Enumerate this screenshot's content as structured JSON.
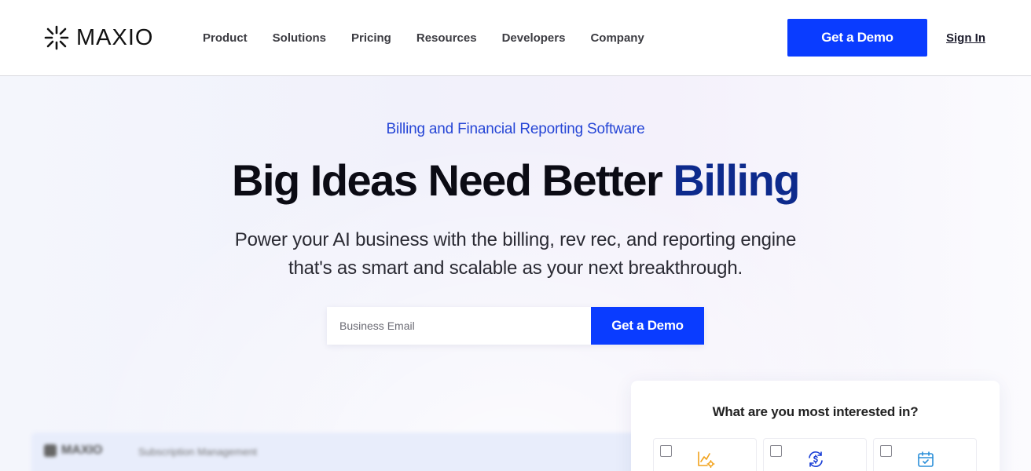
{
  "header": {
    "logo_text": "MAXIO",
    "nav": [
      "Product",
      "Solutions",
      "Pricing",
      "Resources",
      "Developers",
      "Company"
    ],
    "cta_label": "Get a Demo",
    "signin_label": "Sign In"
  },
  "hero": {
    "eyebrow": "Billing and Financial Reporting Software",
    "headline_part1": "Big Ideas Need Better ",
    "headline_accent": "Billing",
    "subhead_line1": "Power your AI business with the billing, rev rec, and reporting engine",
    "subhead_line2": "that's as smart and scalable as your next breakthrough.",
    "email_placeholder": "Business Email",
    "cta_label": "Get a Demo"
  },
  "preview": {
    "logo_text": "MAXIO",
    "title": "Subscription Management"
  },
  "interest_card": {
    "title": "What are you most interested in?",
    "options": [
      {
        "icon": "chart-gear-icon",
        "checked": false
      },
      {
        "icon": "dollar-refresh-icon",
        "checked": false
      },
      {
        "icon": "calendar-check-icon",
        "checked": false
      }
    ]
  },
  "colors": {
    "brand_blue": "#0a3cff",
    "eyebrow_blue": "#2646d6",
    "headline_accent": "#0d2a8c"
  }
}
